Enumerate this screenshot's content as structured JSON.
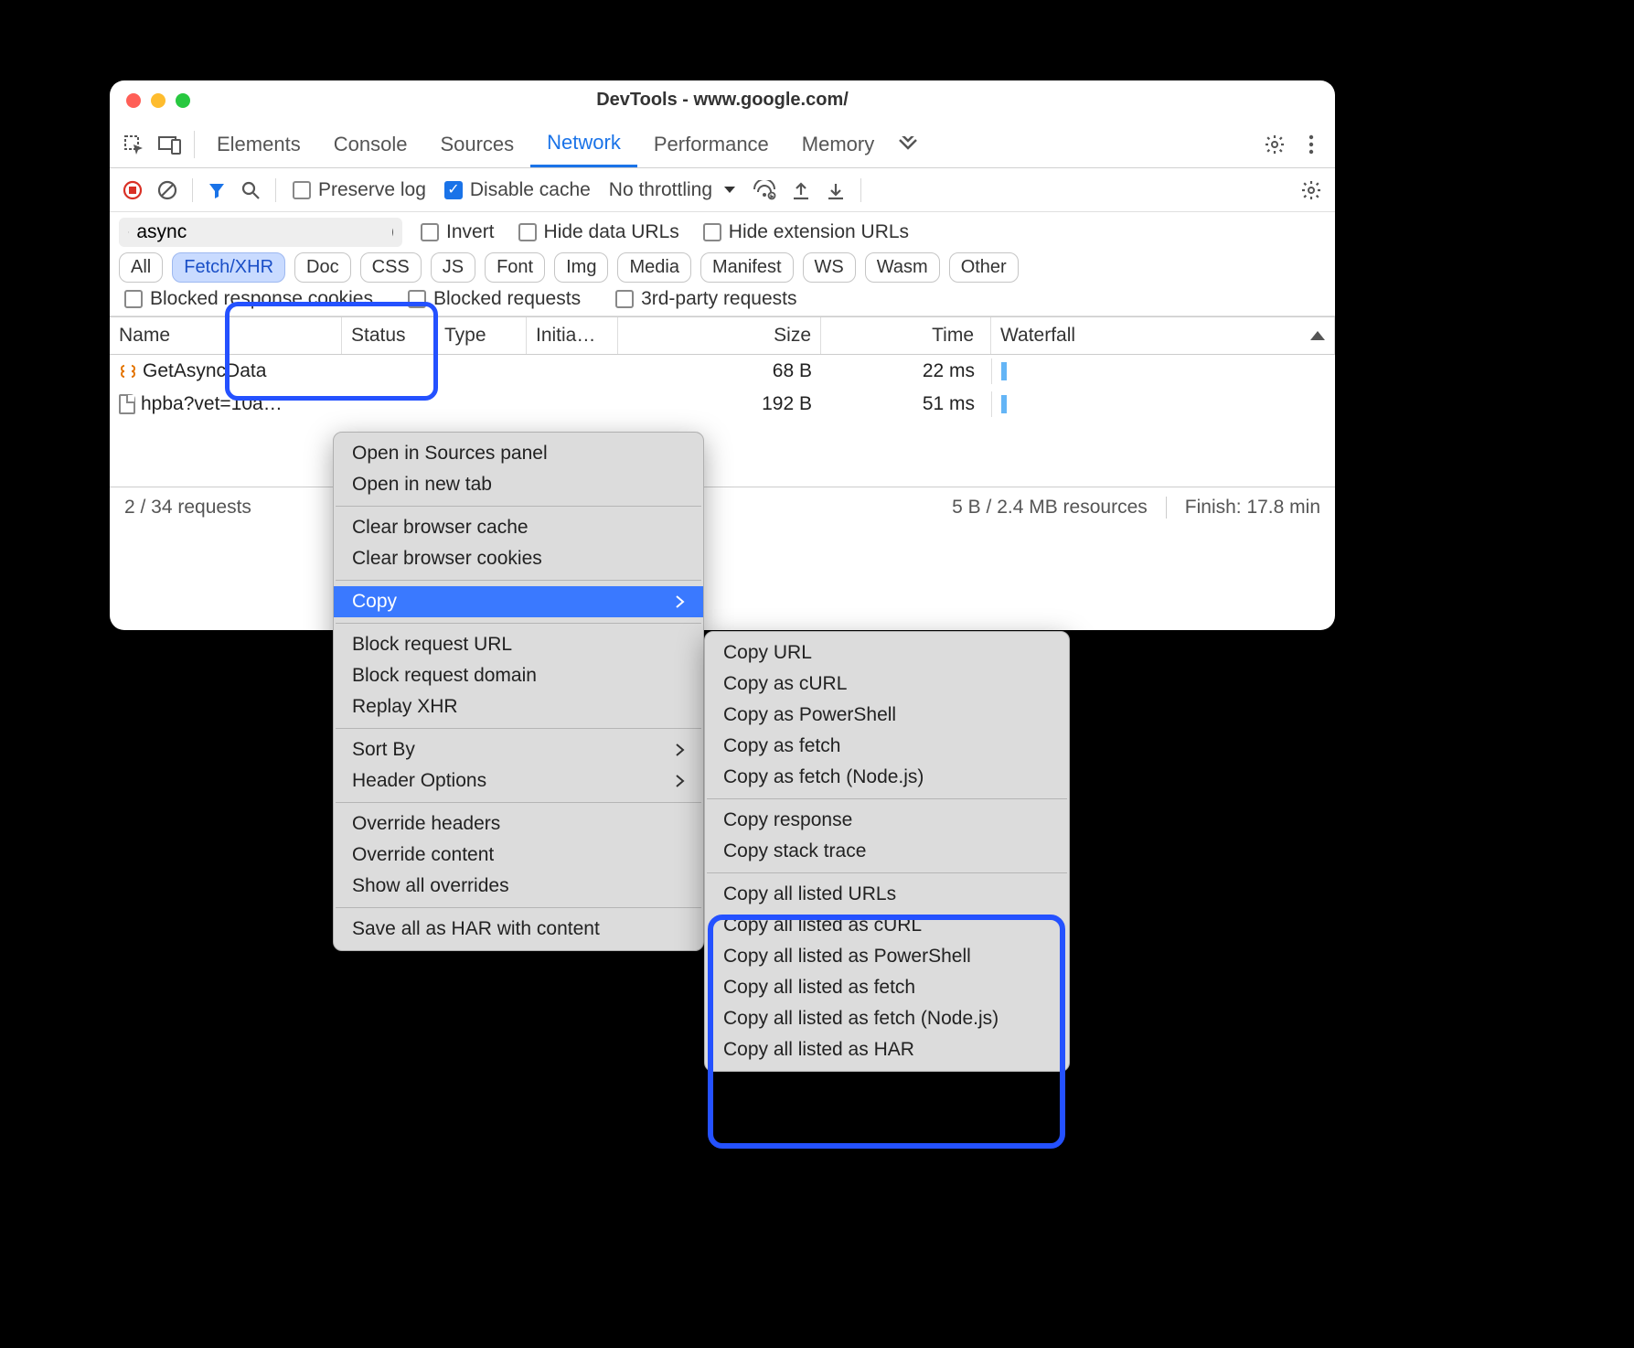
{
  "window": {
    "title": "DevTools - www.google.com/"
  },
  "tabs": [
    "Elements",
    "Console",
    "Sources",
    "Network",
    "Performance",
    "Memory"
  ],
  "active_tab": "Network",
  "toolbar": {
    "preserve_log": "Preserve log",
    "disable_cache": "Disable cache",
    "throttling": "No throttling"
  },
  "filter": {
    "value": "async",
    "invert": "Invert",
    "hide_data_urls": "Hide data URLs",
    "hide_ext_urls": "Hide extension URLs",
    "pills": [
      "All",
      "Fetch/XHR",
      "Doc",
      "CSS",
      "JS",
      "Font",
      "Img",
      "Media",
      "Manifest",
      "WS",
      "Wasm",
      "Other"
    ],
    "active_pill": "Fetch/XHR",
    "blocked_cookies": "Blocked response cookies",
    "blocked_requests": "Blocked requests",
    "third_party": "3rd-party requests"
  },
  "columns": {
    "name": "Name",
    "status": "Status",
    "type": "Type",
    "initiator": "Initia…",
    "size": "Size",
    "time": "Time",
    "waterfall": "Waterfall"
  },
  "rows": [
    {
      "name": "GetAsyncData",
      "size": "68 B",
      "time": "22 ms",
      "icon": "xhr"
    },
    {
      "name": "hpba?vet=10a…",
      "size": "192 B",
      "time": "51 ms",
      "icon": "file"
    }
  ],
  "status": {
    "requests": "2 / 34 requests",
    "resources": "5 B / 2.4 MB resources",
    "finish": "Finish: 17.8 min"
  },
  "context_menu": {
    "items": [
      [
        "Open in Sources panel",
        "Open in new tab"
      ],
      [
        "Clear browser cache",
        "Clear browser cookies"
      ],
      [
        "Copy"
      ],
      [
        "Block request URL",
        "Block request domain",
        "Replay XHR"
      ],
      [
        "Sort By",
        "Header Options"
      ],
      [
        "Override headers",
        "Override content",
        "Show all overrides"
      ],
      [
        "Save all as HAR with content"
      ]
    ],
    "highlighted": "Copy",
    "submenu_parents": [
      "Copy",
      "Sort By",
      "Header Options"
    ]
  },
  "copy_submenu": {
    "groups": [
      [
        "Copy URL",
        "Copy as cURL",
        "Copy as PowerShell",
        "Copy as fetch",
        "Copy as fetch (Node.js)"
      ],
      [
        "Copy response",
        "Copy stack trace"
      ],
      [
        "Copy all listed URLs",
        "Copy all listed as cURL",
        "Copy all listed as PowerShell",
        "Copy all listed as fetch",
        "Copy all listed as fetch (Node.js)",
        "Copy all listed as HAR"
      ]
    ]
  }
}
